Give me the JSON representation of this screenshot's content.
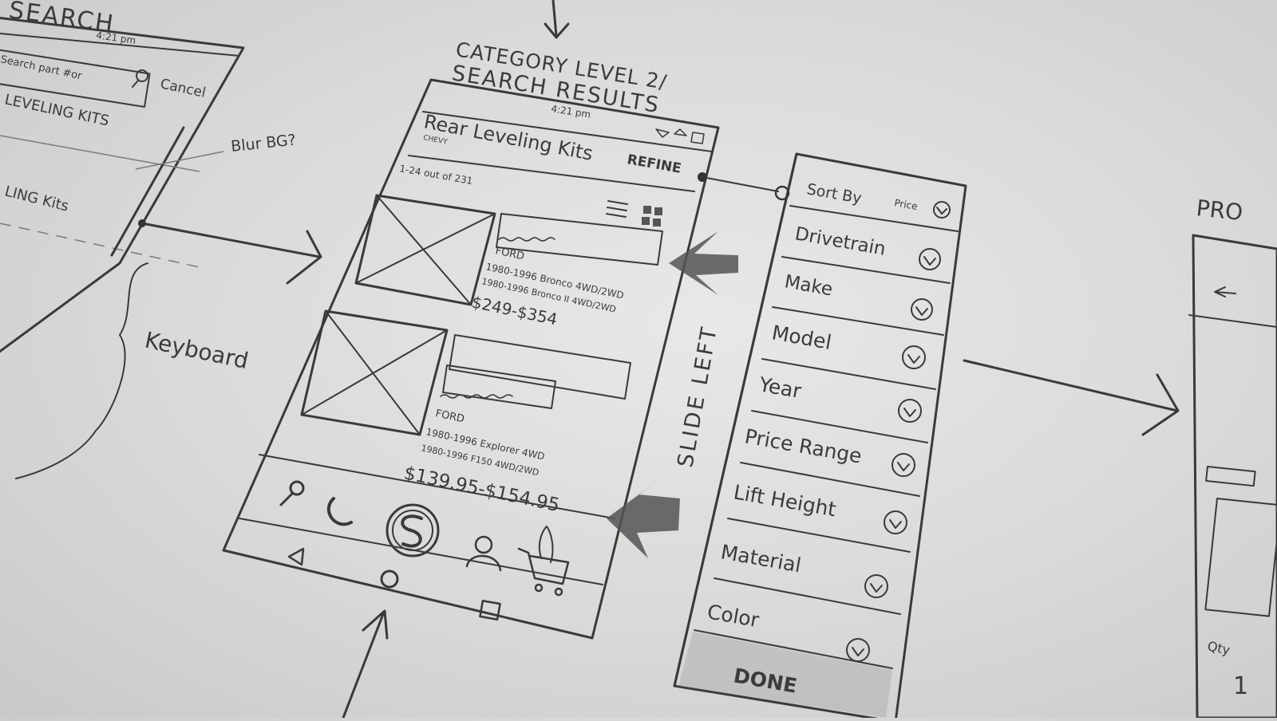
{
  "left_screen": {
    "title": "SEARCH",
    "time": "4:21 pm",
    "search_placeholder": "Search part #or",
    "cancel_label": "Cancel",
    "list_item_1": "LEVELING KITS",
    "list_item_2": "LING Kits",
    "annotation_blur": "Blur BG?",
    "annotation_keyboard": "Keyboard"
  },
  "center_screen": {
    "heading_line1": "CATEGORY LEVEL 2/",
    "heading_line2": "SEARCH RESULTS",
    "time": "4:21 pm",
    "title": "Rear Leveling Kits",
    "subtitle": "CHEVY",
    "refine_label": "REFINE",
    "results_count": "1-24 out of 231",
    "items": [
      {
        "make": "FORD",
        "fitment_1": "1980-1996 Bronco 4WD/2WD",
        "fitment_2": "1980-1996 Bronco II 4WD/2WD",
        "price": "$249-$354"
      },
      {
        "make": "FORD",
        "fitment_1": "1980-1996 Explorer 4WD",
        "fitment_2": "1980-1996 F150 4WD/2WD",
        "price": "$139.95-$154.95"
      }
    ],
    "annotation_slide": "SLIDE LEFT"
  },
  "refine_panel": {
    "sort_label": "Sort By",
    "sort_value": "Price",
    "filters": [
      "Drivetrain",
      "Make",
      "Model",
      "Year",
      "Price Range",
      "Lift Height",
      "Material",
      "Color"
    ],
    "done_label": "DONE"
  },
  "right_screen": {
    "title": "PRO",
    "qty_label": "Qty",
    "qty_value": "1"
  }
}
